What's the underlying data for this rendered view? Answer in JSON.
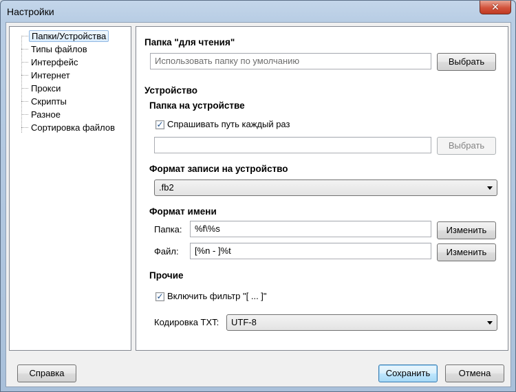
{
  "window": {
    "title": "Настройки",
    "close_glyph": "✕"
  },
  "sidebar": {
    "items": [
      {
        "label": "Папки/Устройства",
        "selected": true
      },
      {
        "label": "Типы файлов"
      },
      {
        "label": "Интерфейс"
      },
      {
        "label": "Интернет"
      },
      {
        "label": "Прокси"
      },
      {
        "label": "Скрипты"
      },
      {
        "label": "Разное"
      },
      {
        "label": "Сортировка файлов"
      }
    ]
  },
  "read_folder": {
    "heading": "Папка \"для чтения\"",
    "placeholder": "Использовать папку по умолчанию",
    "browse_label": "Выбрать"
  },
  "device": {
    "heading": "Устройство",
    "folder_heading": "Папка на устройстве",
    "ask_path_label": "Спрашивать путь каждый раз",
    "ask_path_checked": true,
    "path_value": "",
    "browse_label": "Выбрать",
    "format_heading": "Формат записи на устройство",
    "format_value": ".fb2"
  },
  "name_format": {
    "heading": "Формат имени",
    "folder_label": "Папка:",
    "folder_value": "%f\\%s",
    "file_label": "Файл:",
    "file_value": "[%n - ]%t",
    "change_label": "Изменить"
  },
  "other": {
    "heading": "Прочие",
    "filter_label": "Включить фильтр \"[ ... ]\"",
    "filter_checked": true,
    "encoding_label": "Кодировка TXT:",
    "encoding_value": "UTF-8"
  },
  "footer": {
    "help_label": "Справка",
    "save_label": "Сохранить",
    "cancel_label": "Отмена"
  },
  "check_glyph": "✓"
}
